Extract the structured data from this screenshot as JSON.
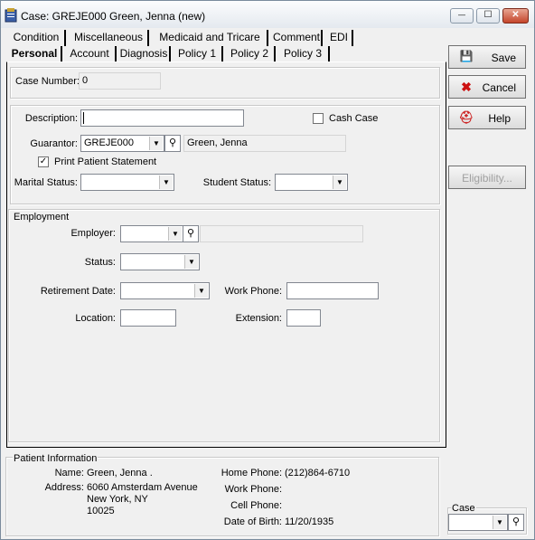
{
  "window": {
    "title": "Case: GREJE000 Green, Jenna  (new)"
  },
  "tabs_top": [
    "Condition",
    "Miscellaneous",
    "Medicaid and Tricare",
    "Comment",
    "EDI"
  ],
  "tabs_bottom": [
    "Personal",
    "Account",
    "Diagnosis",
    "Policy 1",
    "Policy 2",
    "Policy 3"
  ],
  "case_number": {
    "label": "Case Number:",
    "value": "0"
  },
  "description": {
    "label": "Description:",
    "value": ""
  },
  "cash_case": {
    "label": "Cash Case",
    "checked": false
  },
  "guarantor": {
    "label": "Guarantor:",
    "code": "GREJE000",
    "name": "Green, Jenna"
  },
  "print_statement": {
    "label": "Print Patient Statement",
    "checked": true,
    "mark": "✓"
  },
  "marital": {
    "label": "Marital Status:",
    "value": ""
  },
  "student": {
    "label": "Student Status:",
    "value": ""
  },
  "employment": {
    "header": "Employment",
    "employer_label": "Employer:",
    "employer_value": "",
    "status_label": "Status:",
    "status_value": "",
    "retirement_label": "Retirement Date:",
    "retirement_value": "",
    "work_phone_label": "Work Phone:",
    "work_phone_value": "",
    "location_label": "Location:",
    "location_value": "",
    "extension_label": "Extension:",
    "extension_value": ""
  },
  "buttons": {
    "save": "Save",
    "cancel": "Cancel",
    "help": "Help",
    "eligibility": "Eligibility..."
  },
  "patient_info": {
    "header": "Patient Information",
    "name_label": "Name:",
    "name": "Green, Jenna .",
    "address_label": "Address:",
    "address1": "6060 Amsterdam Avenue",
    "address2": "New York, NY",
    "zip": "10025",
    "home_phone_label": "Home Phone:",
    "home_phone": "(212)864-6710",
    "work_phone_label": "Work Phone:",
    "work_phone": "",
    "cell_phone_label": "Cell Phone:",
    "cell_phone": "",
    "dob_label": "Date of Birth:",
    "dob": "11/20/1935"
  },
  "case_selector": {
    "label": "Case",
    "value": ""
  },
  "icons": {
    "dropdown": "▼",
    "search": "⚲",
    "minimize": "—",
    "maximize": "☐",
    "close": "✕",
    "save": "💾",
    "cancel": "✖",
    "help": "⛑"
  }
}
